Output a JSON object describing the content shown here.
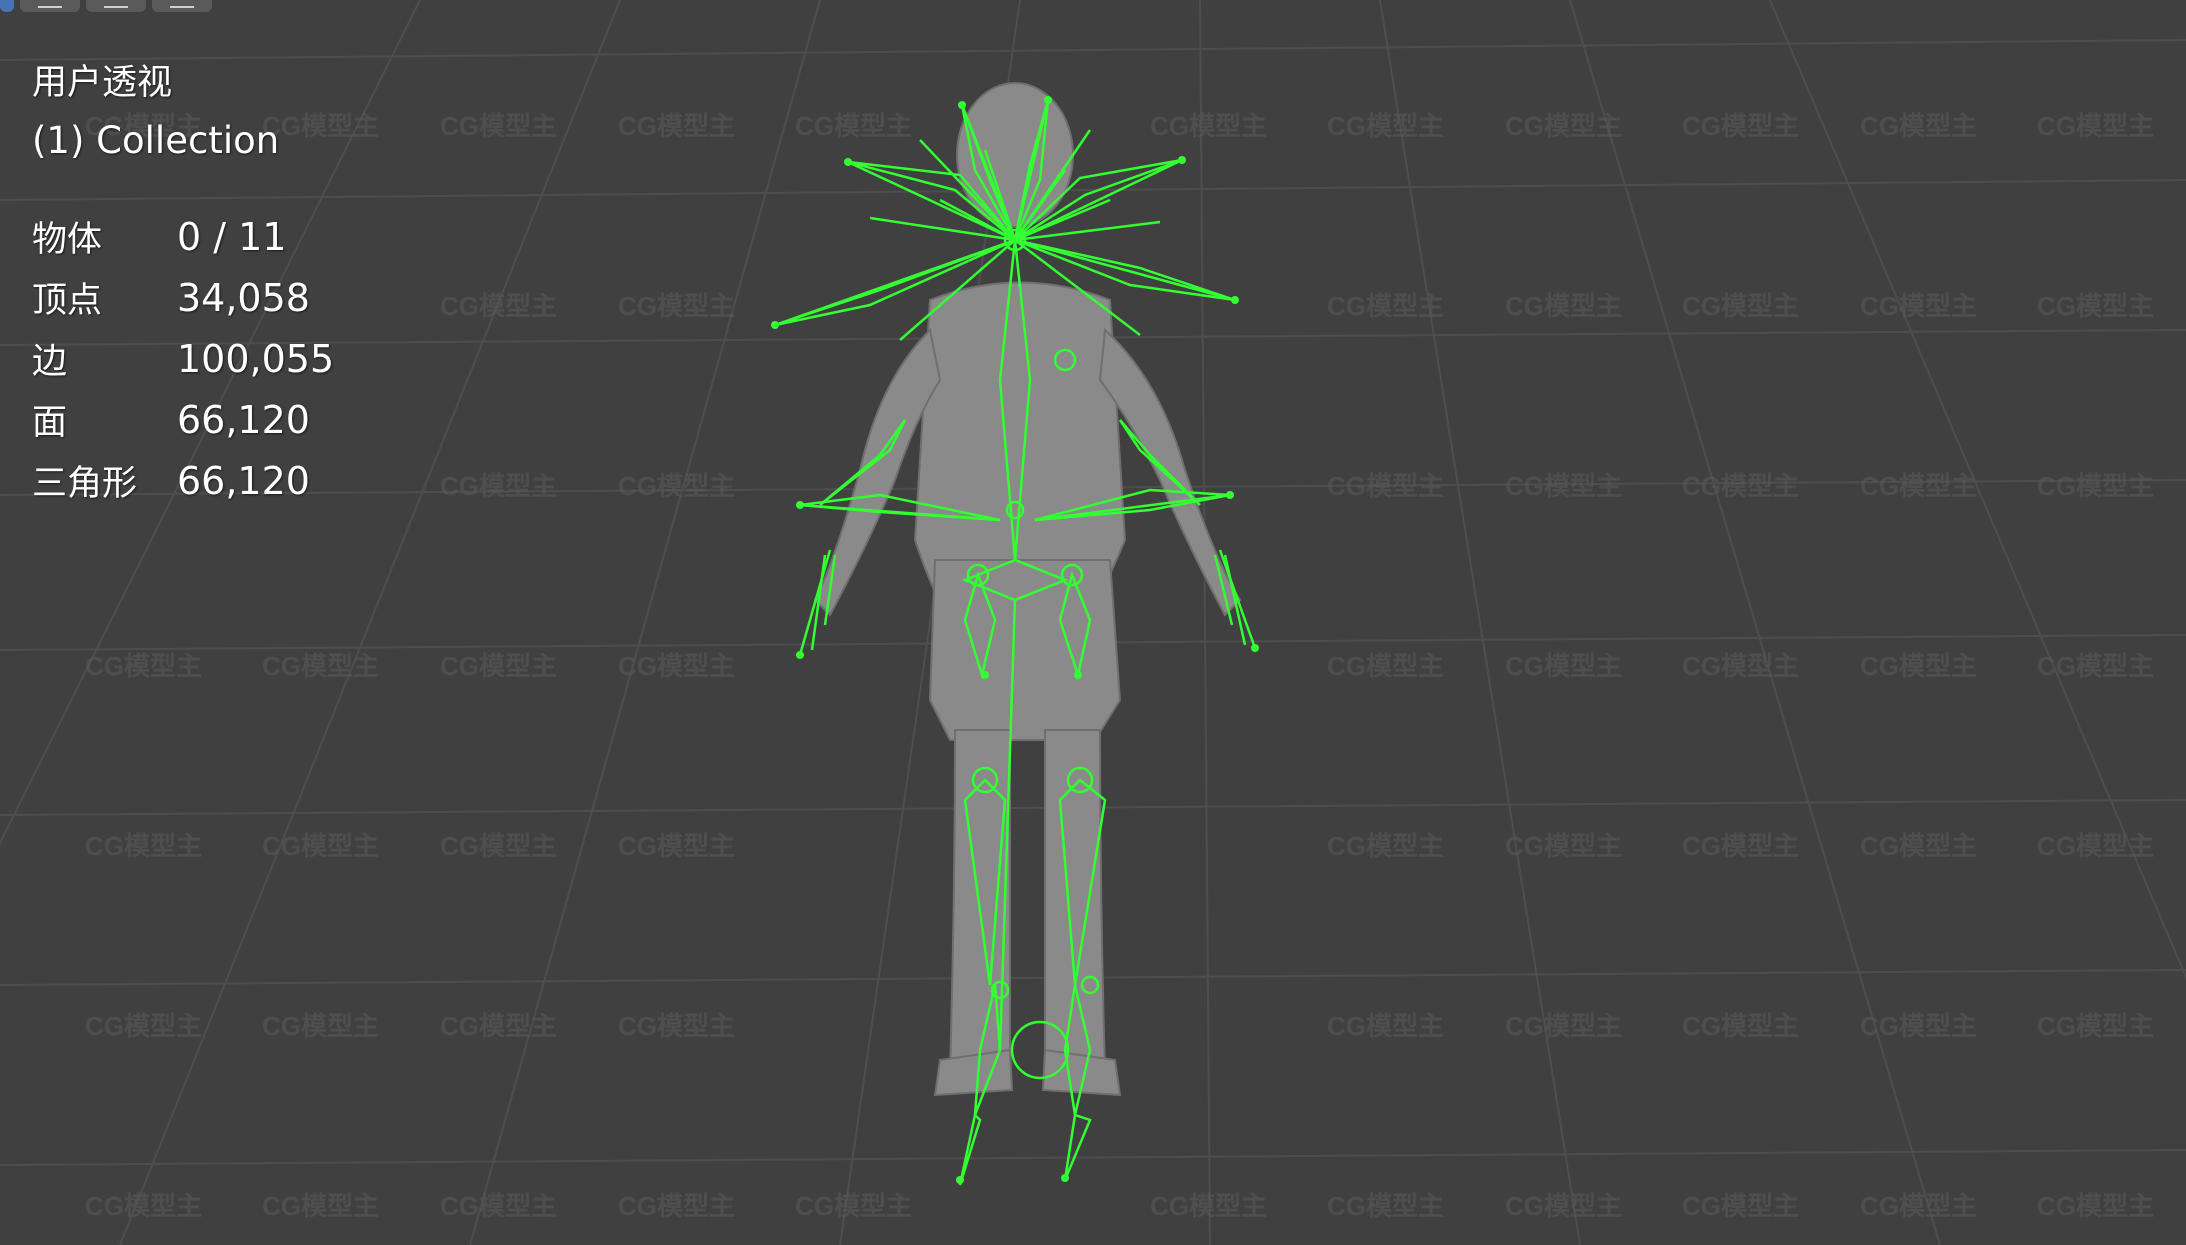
{
  "viewport": {
    "view_name": "用户透视",
    "collection_info": "(1) Collection",
    "background_color": "#404040",
    "grid_color": "#4e4e4e",
    "armature_color": "#33ff33",
    "mesh_color": "#8a8a8a"
  },
  "stats": [
    {
      "label": "物体",
      "value": "0 / 11"
    },
    {
      "label": "顶点",
      "value": "34,058"
    },
    {
      "label": "边",
      "value": "100,055"
    },
    {
      "label": "面",
      "value": "66,120"
    },
    {
      "label": "三角形",
      "value": "66,120"
    }
  ],
  "watermark": {
    "text": "CG模型主"
  },
  "toolbar": {
    "icons": [
      "select-mode-icon",
      "menu-icon",
      "view-icon",
      "options-icon"
    ]
  }
}
